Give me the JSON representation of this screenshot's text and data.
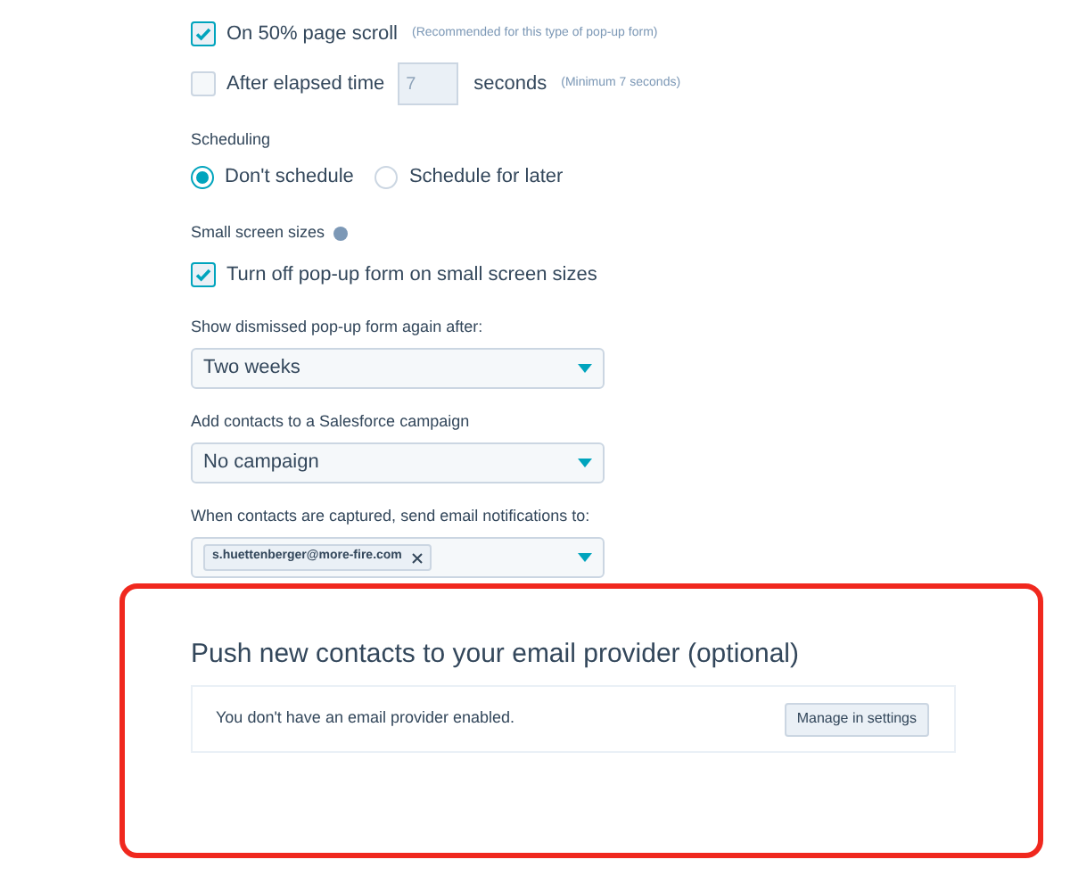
{
  "triggers": [
    {
      "kind": "checkbox",
      "label": "On 50% page scroll",
      "checked": true,
      "hint": "(Recommended for this type of pop-up form)"
    },
    {
      "kind": "timed",
      "label": "After elapsed time",
      "checked": false,
      "placeholder": "7",
      "unit": "seconds",
      "hint": "(Minimum 7 seconds)"
    }
  ],
  "scheduling": {
    "label": "Scheduling",
    "options": [
      {
        "label": "Don't schedule",
        "selected": true
      },
      {
        "label": "Schedule for later",
        "selected": false
      }
    ]
  },
  "small_screen": {
    "label": "Small screen sizes",
    "option": {
      "label": "Turn off pop-up form on small screen sizes",
      "checked": true
    }
  },
  "dropdowns": [
    {
      "label": "Show dismissed pop-up form again after:",
      "value": "Two weeks"
    },
    {
      "label": "Add contacts to a Salesforce campaign",
      "value": "No campaign"
    },
    {
      "label": "When contacts are captured, send email notifications to:",
      "tags": [
        "s.huettenberger@more-fire.com"
      ]
    }
  ],
  "email_provider": {
    "title": "Push new contacts to your email provider (optional)",
    "message": "You don't have an email provider enabled.",
    "button": "Manage in settings"
  }
}
